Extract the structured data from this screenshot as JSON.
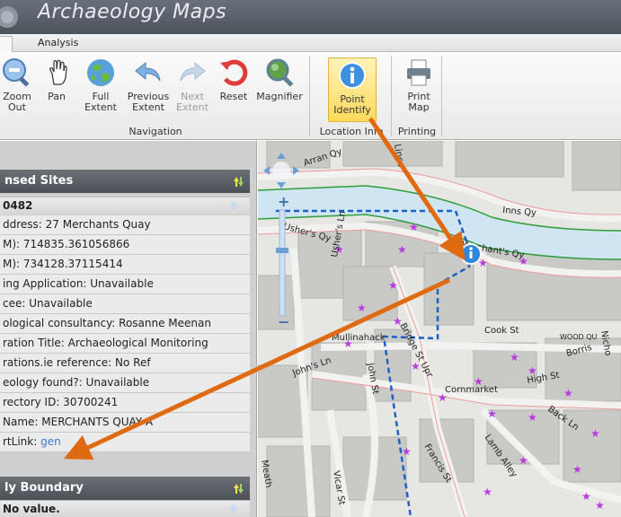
{
  "app": {
    "title": "Archaeology Maps"
  },
  "tabs": [
    {
      "label": ""
    },
    {
      "label": "Analysis"
    }
  ],
  "ribbon": {
    "buttons": [
      {
        "id": "zoom-out",
        "label": "Zoom\nOut",
        "icon": "zoom-out-icon",
        "enabled": true
      },
      {
        "id": "pan",
        "label": "Pan",
        "icon": "pan-hand-icon",
        "enabled": true
      },
      {
        "id": "full-extent",
        "label": "Full\nExtent",
        "icon": "globe-icon",
        "enabled": true
      },
      {
        "id": "previous-extent",
        "label": "Previous\nExtent",
        "icon": "undo-arrow-icon",
        "enabled": true
      },
      {
        "id": "next-extent",
        "label": "Next\nExtent",
        "icon": "redo-arrow-icon",
        "enabled": false
      },
      {
        "id": "reset",
        "label": "Reset",
        "icon": "reset-icon",
        "enabled": true
      },
      {
        "id": "magnifier",
        "label": "Magnifier",
        "icon": "magnifier-icon",
        "enabled": true
      },
      {
        "id": "point-identify",
        "label": "Point\nIdentify",
        "icon": "info-icon",
        "enabled": true,
        "active": true
      },
      {
        "id": "print-map",
        "label": "Print\nMap",
        "icon": "printer-icon",
        "enabled": true
      }
    ],
    "groups": {
      "navigation": "Navigation",
      "location_info": "Location Info",
      "printing": "Printing"
    }
  },
  "panel": {
    "section1": {
      "title": "nsed Sites",
      "record_id": "0482"
    },
    "fields": [
      "ddress: 27 Merchants Quay",
      "M): 714835.361056866",
      "M): 734128.37115414",
      "ing Application: Unavailable",
      "cee: Unavailable",
      "ological consultancy: Rosanne Meenan",
      "ration Title: Archaeological Monitoring",
      "rations.ie reference: No Ref",
      "eology found?: Unavailable",
      "rectory ID: 30700241",
      "Name: MERCHANTS QUAY A"
    ],
    "link_field": {
      "label": "rtLink: ",
      "link_text": "gen"
    },
    "section2": {
      "title": "ly Boundary",
      "record_id": "No value."
    }
  },
  "map": {
    "streets": {
      "arran_quay": "Arran Qy",
      "ushers_quay": "Usher's Qy",
      "inns_quay": "Inns Qy",
      "merchants_quay": "Merchant's Qy",
      "mullinahack": "Mullinahack",
      "cook_st": "Cook St",
      "bridge_st_upr": "Bridge St Upr",
      "johns_ln": "John's Ln",
      "john_st": "John St",
      "cornmarket": "Cornmarket",
      "high_st": "High St",
      "francis_st": "Francis St",
      "back_ln": "Back Ln",
      "lamb_alley": "Lamb Alley",
      "borris": "Borris",
      "meath": "Meath",
      "vicar_st": "Vicar St",
      "nicholas": "Nicho",
      "usher_ln": "Usher's Ln",
      "lincoln": "Linco",
      "wood_quay": "WOOD QU"
    }
  },
  "colors": {
    "title_bar": "#5a6068",
    "panel_header": "#5b6066",
    "annotation_arrow": "#e06a12",
    "river": "#cfe6f2",
    "boundary_dash": "#1f5fc8",
    "site_marker": "#b83ae0"
  }
}
